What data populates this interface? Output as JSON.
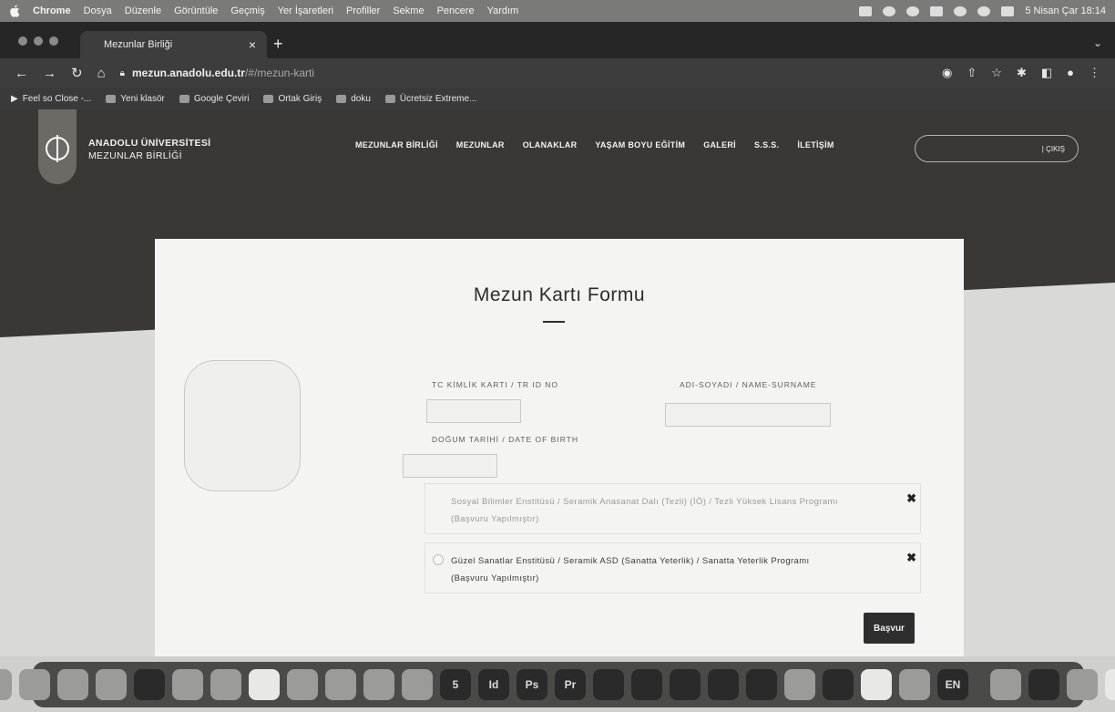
{
  "menubar": {
    "items": [
      "Chrome",
      "Dosya",
      "Düzenle",
      "Görüntüle",
      "Geçmiş",
      "Yer İşaretleri",
      "Profiller",
      "Sekme",
      "Pencere",
      "Yardım"
    ],
    "clock": "5 Nisan Çar 18:14"
  },
  "browser": {
    "tab_title": "Mezunlar Birliği",
    "url_host": "mezun.anadolu.edu.tr",
    "url_path": "/#/mezun-karti",
    "bookmarks": [
      "Feel so Close -...",
      "Yeni klasör",
      "Google Çeviri",
      "Ortak Giriş",
      "doku",
      "Ücretsiz Extreme..."
    ]
  },
  "site": {
    "brand_line1": "ANADOLU ÜNİVERSİTESİ",
    "brand_line2": "MEZUNLAR BİRLİĞİ",
    "nav": [
      "MEZUNLAR BİRLİĞİ",
      "MEZUNLAR",
      "OLANAKLAR",
      "YAŞAM BOYU EĞİTİM",
      "GALERİ",
      "S.S.S.",
      "İLETİŞİM"
    ],
    "login_label": "| ÇIKIŞ"
  },
  "form": {
    "title": "Mezun Kartı Formu",
    "tc_label": "TC KİMLİK KARTI / TR ID NO",
    "name_label": "ADI-SOYADI / NAME-SURNAME",
    "dob_label": "DOĞUM TARİHİ / DATE OF BIRTH",
    "tc_value": "",
    "name_value": "",
    "dob_value": "",
    "programs": [
      {
        "text": "Sosyal Bilimler Enstitüsü / Seramik Anasanat Dalı (Tezli) (İÖ) / Tezli Yüksek Lisans Programı",
        "status": "(Başvuru Yapılmıştır)"
      },
      {
        "text": "Güzel Sanatlar Enstitüsü / Seramik ASD (Sanatta Yeterlik) / Sanatta Yeterlik Programı",
        "status": "(Başvuru Yapılmıştır)"
      }
    ],
    "apply_label": "Başvur"
  },
  "dock": {
    "labels": [
      "5",
      "Id",
      "Ps",
      "Pr",
      "EN"
    ]
  },
  "colors": {
    "hero_bg": "#3a3734",
    "card_bg": "#f4f4f2",
    "button_bg": "#2e2e2e"
  }
}
